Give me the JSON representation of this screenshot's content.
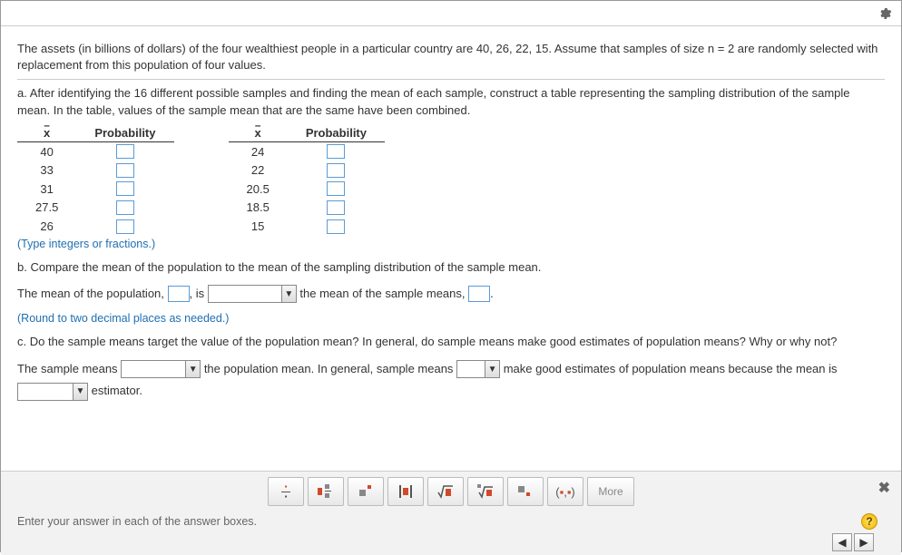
{
  "problem": {
    "intro": "The assets (in billions of dollars) of the four wealthiest people in a particular country are 40, 26, 22, 15. Assume that samples of size n = 2 are randomly selected with replacement from this population of four values.",
    "partA": "a. After identifying the 16 different possible samples and finding the mean of each sample, construct a table representing the sampling distribution of the sample mean. In the table, values of the sample mean that are the same have been combined.",
    "table1": {
      "col1": "x",
      "col2": "Probability",
      "rows": [
        "40",
        "33",
        "31",
        "27.5",
        "26"
      ]
    },
    "table2": {
      "col1": "x",
      "col2": "Probability",
      "rows": [
        "24",
        "22",
        "20.5",
        "18.5",
        "15"
      ]
    },
    "hintA": "(Type integers or fractions.)",
    "partB": "b. Compare the mean of the population to the mean of the sampling distribution of the sample mean.",
    "b_text1": "The mean of the population,",
    "b_is": ", is",
    "b_text2": "the mean of the sample means,",
    "b_period": ".",
    "hintB": "(Round to two decimal places as needed.)",
    "partC": "c. Do the sample means target the value of the population mean? In general, do sample means make good estimates of population means? Why or why not?",
    "c_text1": "The sample means",
    "c_text2": "the population mean. In general, sample means",
    "c_text3": "make good estimates of population means because the mean is",
    "c_text4": "estimator."
  },
  "toolbar": {
    "more": "More"
  },
  "footer": {
    "prompt": "Enter your answer in each of the answer boxes.",
    "help": "?"
  }
}
